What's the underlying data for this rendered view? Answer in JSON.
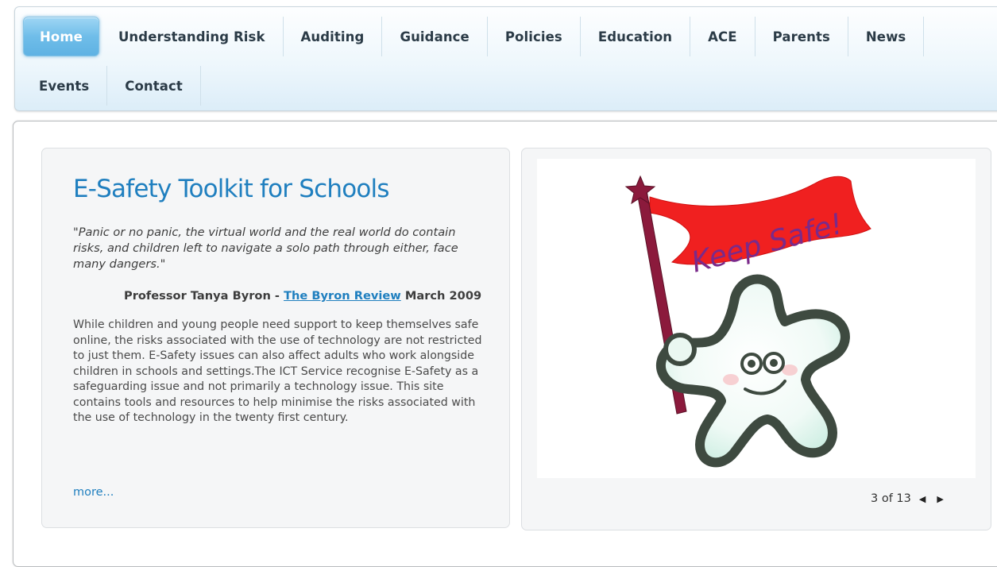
{
  "nav": {
    "row1": [
      "Home",
      "Understanding Risk",
      "Auditing",
      "Guidance",
      "Policies",
      "Education",
      "ACE",
      "Parents",
      "News"
    ],
    "row2": [
      "Events",
      "Contact"
    ]
  },
  "intro": {
    "title": "E-Safety Toolkit for Schools",
    "quote": "\"Panic or no panic, the virtual world and the real world do contain risks, and children left to navigate a solo path through either, face many dangers.\"",
    "attribution_author": "Professor Tanya Byron - ",
    "attribution_link": "The Byron Review",
    "attribution_date": " March 2009",
    "body": "While children and young people need support to keep themselves safe online, the risks associated with the use of technology are not restricted to just them. E-Safety issues can also affect adults who work alongside children in schools and settings.The ICT Service recognise E-Safety as a safeguarding issue and not primarily a technology issue. This site contains tools and resources to help minimise the risks associated with the use of technology in the twenty first century.",
    "more_label": "more..."
  },
  "slideshow": {
    "flag_text": "Keep Safe!",
    "counter": "3 of 13",
    "prev_icon": "◀",
    "next_icon": "▶"
  },
  "colors": {
    "accent": "#1f7fbf",
    "home_tab": "#6fbde9",
    "flag_red": "#f02020",
    "pole": "#8b1a3c"
  }
}
